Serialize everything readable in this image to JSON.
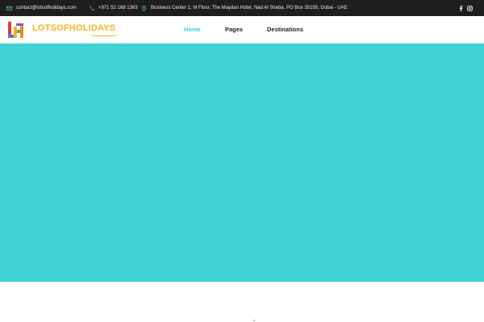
{
  "topbar": {
    "email": "contact@lotsofholidays.com",
    "phone": "+971 52 168 1363",
    "address": "Business Center 1, M Floor, The Maydan Hotel, Nad Al Sheba, PO Box 35195, Dubai - UAE",
    "icon_color": "#3ecfd2",
    "social": [
      "facebook-icon",
      "instagram-icon"
    ]
  },
  "header": {
    "logo_text": "LOTSOFHOLIDAYS",
    "logo_color": "#f4b322",
    "nav": [
      {
        "label": "Home",
        "active": true
      },
      {
        "label": "Pages",
        "active": false
      },
      {
        "label": "Destinations",
        "active": false
      }
    ],
    "active_color": "#3ecfd2"
  },
  "hero": {
    "background": "#3ed2d5"
  }
}
